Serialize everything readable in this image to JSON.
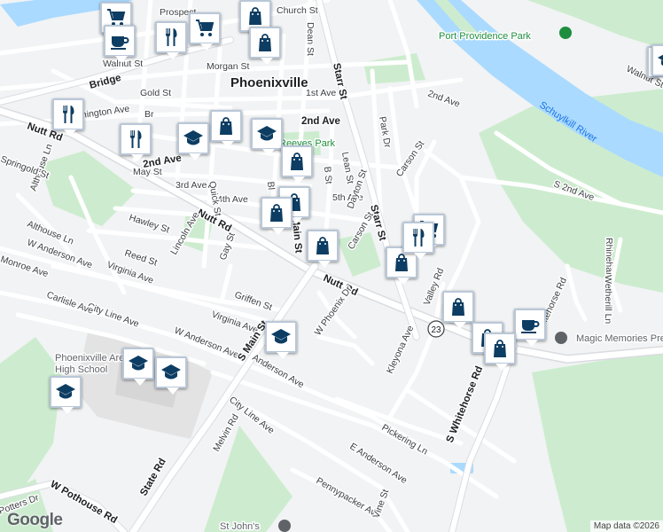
{
  "map": {
    "town_label": "Phoenixville",
    "parks": [
      {
        "id": "port-providence-park",
        "label": "Port Providence Park"
      },
      {
        "id": "reeves-park",
        "label": "Reeves Park"
      },
      {
        "id": "magic-memories",
        "label": "Magic Memories Preschool and C"
      },
      {
        "id": "st-johns",
        "label": "St John's"
      },
      {
        "id": "phoenixville-hs-line1",
        "label": "Phoenixville Area"
      },
      {
        "id": "phoenixville-hs-line2",
        "label": "High School"
      }
    ],
    "water_label": "Schuylkill River",
    "route_shield": "23",
    "streets": [
      "Church St",
      "Prospect",
      "Dean St",
      "Walnut St",
      "Morgan St",
      "Bridge",
      "Gold St",
      "1st Ave",
      "2nd Ave",
      "2nd Ave",
      "2nd Ave",
      "3rd Ave",
      "4th Ave",
      "5th Ave",
      "May St",
      "Washington Ave",
      "Quick St",
      "Nutt Rd",
      "Nutt Rd",
      "Nutt Rd",
      "Starr St",
      "Starr St",
      "Park Dr",
      "Carson St",
      "Carson St",
      "Lean St",
      "B St",
      "Main St",
      "Dayton St",
      "S 2nd Ave",
      "Rhinehart Ln",
      "Wetherill Ln",
      "Walnut St",
      "Hawley St",
      "Lincoln Ave",
      "Reed St",
      "Gay St",
      "Virginia Ave",
      "Virginia Ave",
      "W Anderson Ave",
      "W Anderson Ave",
      "Griffen St",
      "City Line Ave",
      "City Line Ave",
      "Carlisle Ave",
      "Monroe Ave",
      "S Main St",
      "W Phoenix Dr",
      "Valley Rd",
      "Kleyona Ave",
      "Anderson Ave",
      "E Anderson Ave",
      "S Whitehorse Rd",
      "Whitehorse Rd",
      "Pickering Ln",
      "Pennypacker Ave",
      "Vine St",
      "Melvin Rd",
      "State Rd",
      "W Pothouse Rd",
      "Althouse Ln",
      "Althouse Ln",
      "Springold St",
      "Potters Dr",
      "Bl",
      "Br"
    ]
  },
  "markers": [
    {
      "id": "shop-cart-1",
      "icon": "shopping-cart-icon",
      "label": "Grocery store"
    },
    {
      "id": "shop-cart-2",
      "icon": "shopping-cart-icon",
      "label": "Grocery store"
    },
    {
      "id": "shop-bag-1",
      "icon": "shopping-bag-icon",
      "label": "Shop"
    },
    {
      "id": "coffee-1",
      "icon": "coffee-cup-icon",
      "label": "Cafe"
    },
    {
      "id": "restaurant-1",
      "icon": "fork-knife-icon",
      "label": "Restaurant"
    },
    {
      "id": "shop-bag-2",
      "icon": "shopping-bag-icon",
      "label": "Shop"
    },
    {
      "id": "restaurant-2",
      "icon": "fork-knife-icon",
      "label": "Restaurant"
    },
    {
      "id": "shop-bag-3",
      "icon": "shopping-bag-icon",
      "label": "Shop"
    },
    {
      "id": "restaurant-3",
      "icon": "fork-knife-icon",
      "label": "Restaurant"
    },
    {
      "id": "school-1",
      "icon": "graduation-cap-icon",
      "label": "School"
    },
    {
      "id": "school-2",
      "icon": "graduation-cap-icon",
      "label": "School"
    },
    {
      "id": "shop-bag-4",
      "icon": "shopping-bag-icon",
      "label": "Shop"
    },
    {
      "id": "shop-bag-5",
      "icon": "shopping-bag-icon",
      "label": "Shop"
    },
    {
      "id": "shop-bag-6",
      "icon": "shopping-bag-icon",
      "label": "Shop"
    },
    {
      "id": "shop-bag-7",
      "icon": "shopping-bag-icon",
      "label": "Shop"
    },
    {
      "id": "school-3",
      "icon": "graduation-cap-icon",
      "label": "School"
    },
    {
      "id": "school-4",
      "icon": "graduation-cap-icon",
      "label": "School"
    },
    {
      "id": "school-5",
      "icon": "graduation-cap-icon",
      "label": "School"
    },
    {
      "id": "school-6",
      "icon": "graduation-cap-icon",
      "label": "School"
    },
    {
      "id": "shop-bag-8",
      "icon": "shopping-bag-icon",
      "label": "Shop"
    },
    {
      "id": "shop-cart-3",
      "icon": "shopping-cart-icon",
      "label": "Grocery store"
    },
    {
      "id": "restaurant-4",
      "icon": "fork-knife-icon",
      "label": "Restaurant"
    },
    {
      "id": "shop-bag-9",
      "icon": "shopping-bag-icon",
      "label": "Shop"
    },
    {
      "id": "shop-bag-10",
      "icon": "shopping-bag-icon",
      "label": "Shop"
    },
    {
      "id": "coffee-2",
      "icon": "coffee-cup-icon",
      "label": "Cafe"
    },
    {
      "id": "shop-bag-11",
      "icon": "shopping-bag-icon",
      "label": "Shop"
    },
    {
      "id": "shop-bag-12",
      "icon": "shopping-bag-icon",
      "label": "Shop"
    },
    {
      "id": "school-7",
      "icon": "graduation-cap-icon",
      "label": "School"
    }
  ],
  "branding": {
    "logo_text": "Google",
    "attribution": "Map data ©2026"
  },
  "colors": {
    "land": "#f1f3f4",
    "road": "#ffffff",
    "road_outline": "#dadce0",
    "park": "#cdeccf",
    "water": "#aadaff",
    "marker_icon": "#0d3d63"
  }
}
